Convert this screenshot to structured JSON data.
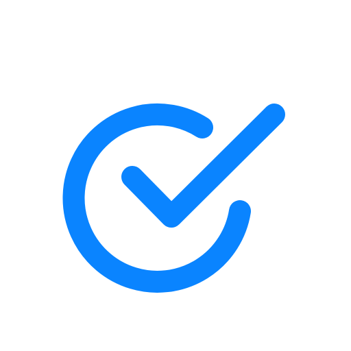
{
  "icon": {
    "name": "check-circle-icon",
    "color": "#0A84FF",
    "background": "#FFFFFF"
  }
}
